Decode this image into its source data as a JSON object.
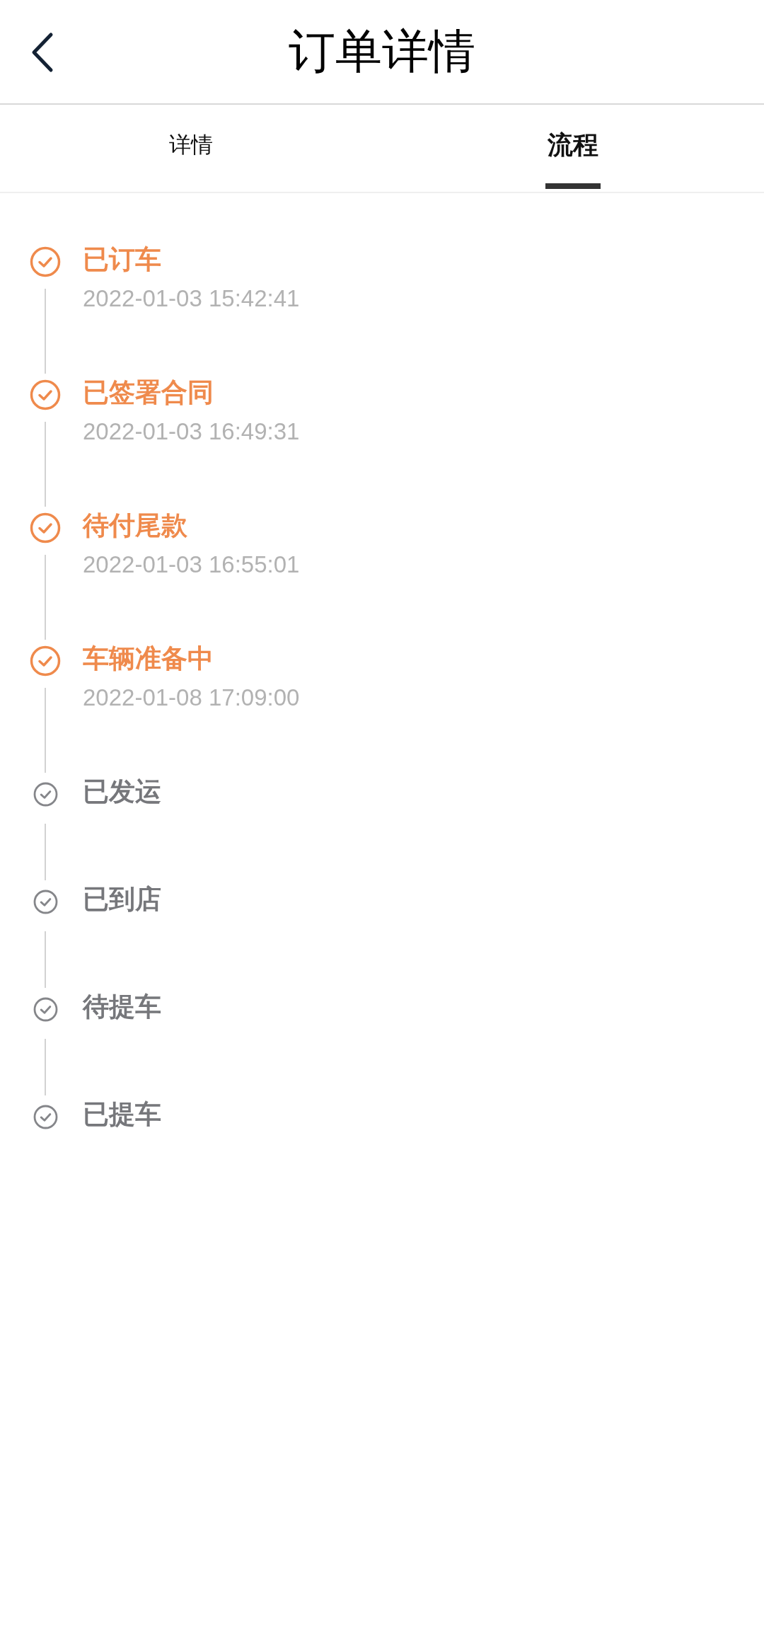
{
  "header": {
    "title": "订单详情"
  },
  "tabs": [
    {
      "label": "详情",
      "selected": false
    },
    {
      "label": "流程",
      "selected": true
    }
  ],
  "timeline": [
    {
      "title": "已订车",
      "time": "2022-01-03 15:42:41",
      "completed": true
    },
    {
      "title": "已签署合同",
      "time": "2022-01-03 16:49:31",
      "completed": true
    },
    {
      "title": "待付尾款",
      "time": "2022-01-03 16:55:01",
      "completed": true
    },
    {
      "title": "车辆准备中",
      "time": "2022-01-08 17:09:00",
      "completed": true
    },
    {
      "title": "已发运",
      "completed": false
    },
    {
      "title": "已到店",
      "completed": false
    },
    {
      "title": "待提车",
      "completed": false
    },
    {
      "title": "已提车",
      "completed": false
    }
  ]
}
